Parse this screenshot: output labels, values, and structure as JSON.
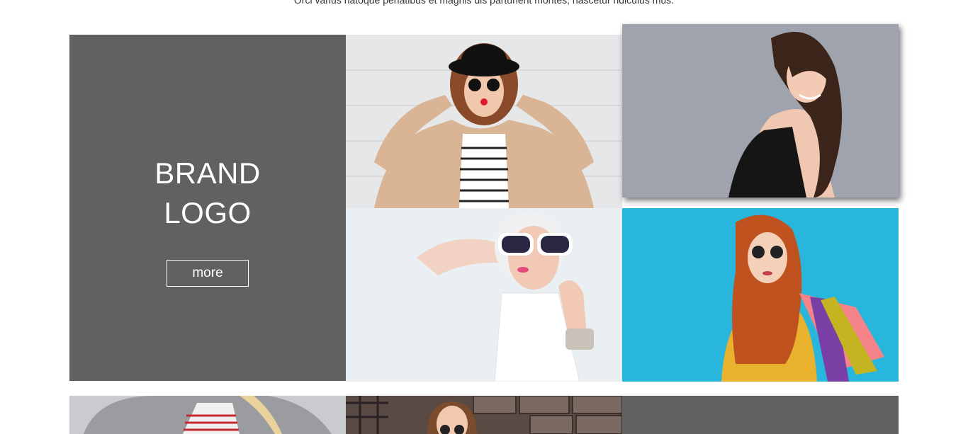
{
  "intro": {
    "text": "Orci varius natoque penatibus et magnis dis parturient montes, nascetur ridiculus mus."
  },
  "brand": {
    "logo_line1": "BRAND",
    "logo_line2": "LOGO",
    "more_label": "more"
  },
  "colors": {
    "tile_gray": "#616161",
    "white": "#ffffff",
    "photo_gray_bg": "#9ea3ad",
    "photo_blue_bg": "#29b6dc"
  },
  "gallery": {
    "photos": [
      {
        "subject": "woman-black-hat-sunglasses"
      },
      {
        "subject": "woman-long-curly-hair-smiling"
      },
      {
        "subject": "blonde-woman-white-sunglasses"
      },
      {
        "subject": "redhead-woman-shopping-bags"
      },
      {
        "subject": "woman-fur-coat"
      },
      {
        "subject": "woman-sunglasses-stone-wall"
      }
    ]
  }
}
